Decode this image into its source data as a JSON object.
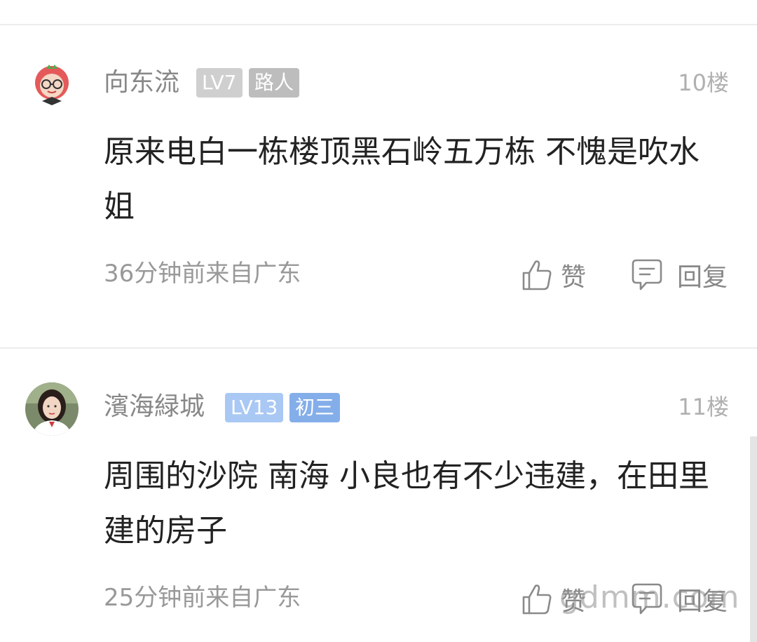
{
  "comments": [
    {
      "username": "向东流",
      "level": "LV7",
      "title": "路人",
      "floor": "10楼",
      "text": "原来电白一栋楼顶黑石岭五万栋  不愧是吹水姐",
      "meta": "36分钟前来自广东",
      "like_label": "赞",
      "reply_label": "回复"
    },
    {
      "username": "濱海緑城",
      "level": "LV13",
      "title": "初三",
      "floor": "11楼",
      "text": "周围的沙院 南海 小良也有不少违建，在田里建的房子",
      "meta": "25分钟前来自广东",
      "like_label": "赞",
      "reply_label": "回复"
    }
  ],
  "watermark": "gdmm.com",
  "colors": {
    "badge_gray": "#cfcfcf",
    "badge_gray_dark": "#bdbdbd",
    "badge_blue_light": "#a9c8f3",
    "badge_blue": "#84aeea"
  }
}
